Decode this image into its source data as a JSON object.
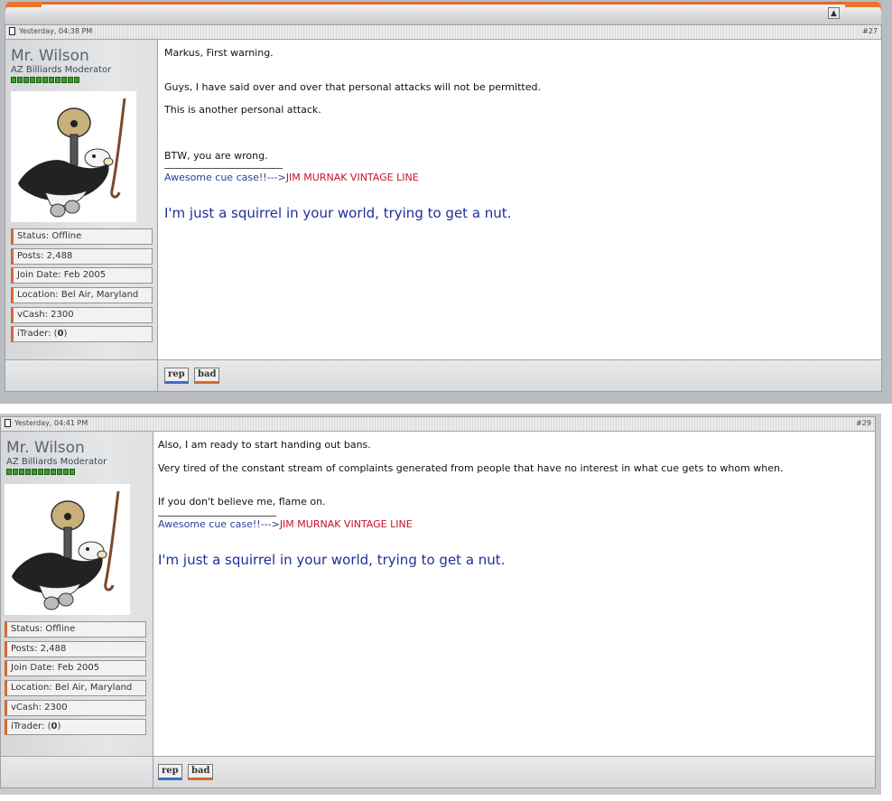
{
  "posts": [
    {
      "date": "Yesterday, 04:38 PM",
      "number": "#27",
      "username": "Mr. Wilson",
      "user_title": "AZ Billiards Moderator",
      "info": [
        "Status: Offline",
        "Posts: 2,488",
        "Join Date: Feb 2005",
        "Location: Bel Air, Maryland",
        "vCash: 2300"
      ],
      "itrader_prefix": "iTrader: (",
      "itrader_value": "0",
      "itrader_suffix": ")",
      "lines": [
        "Markus, First warning.",
        "Guys, I have said over and over that personal attacks will not be permitted.",
        "This is another personal attack.",
        "BTW, you are wrong."
      ],
      "signature_link_a": "Awesome cue case!!--->",
      "signature_link_b": "JIM MURNAK VINTAGE LINE",
      "signature_quote": "I'm just a squirrel in your world, trying to get a nut.",
      "rep_button": "rep",
      "bad_button": "bad"
    },
    {
      "date": "Yesterday, 04:41 PM",
      "number": "#29",
      "username": "Mr. Wilson",
      "user_title": "AZ Billiards Moderator",
      "info": [
        "Status: Offline",
        "Posts: 2,488",
        "Join Date: Feb 2005",
        "Location: Bel Air, Maryland",
        "vCash: 2300"
      ],
      "itrader_prefix": "iTrader: (",
      "itrader_value": "0",
      "itrader_suffix": ")",
      "lines": [
        "Also, I am ready to start handing out bans.",
        "Very tired of the constant stream of complaints generated from people that have no interest in what cue gets to whom when.",
        "If you don't believe me, flame on."
      ],
      "signature_link_a": "Awesome cue case!!--->",
      "signature_link_b": "JIM MURNAK VINTAGE LINE",
      "signature_quote": "I'm just a squirrel in your world, trying to get a nut.",
      "rep_button": "rep",
      "bad_button": "bad"
    }
  ],
  "colors": {
    "accent_orange": "#d66a2c",
    "signature_blue": "#1f2f9a",
    "signature_red": "#c8102e",
    "reputation_green": "#3f9a2f"
  },
  "icons": {
    "collapse": "collapse-icon",
    "post": "post-icon",
    "avatar": "skunk-guitar-avatar"
  }
}
